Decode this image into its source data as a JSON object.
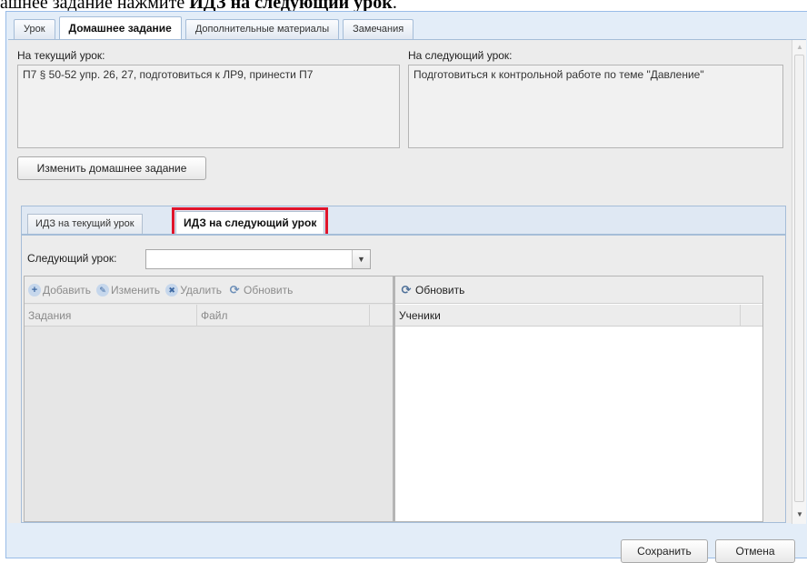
{
  "doc_caption": {
    "text_normal": "ашнее задание нажмите ",
    "text_bold": "ИДЗ на следующий урок",
    "text_end": "."
  },
  "tabs": [
    {
      "label": "Урок",
      "active": false
    },
    {
      "label": "Домашнее задание",
      "active": true
    },
    {
      "label": "Дополнительные материалы",
      "active": false
    },
    {
      "label": "Замечания",
      "active": false
    }
  ],
  "homework": {
    "current_label": "На текущий урок:",
    "current_text": "П7 § 50-52 упр. 26, 27, подготовиться к ЛР9, принести П7",
    "next_label": "На следующий урок:",
    "next_text": "Подготовиться к контрольной работе по теме \"Давление\"",
    "change_button": "Изменить домашнее задание"
  },
  "sub_tabs": [
    {
      "label": "ИДЗ на текущий урок",
      "active": false
    },
    {
      "label": "ИДЗ на следующий урок",
      "active": true
    }
  ],
  "next_lesson": {
    "label": "Следующий урок:",
    "value": ""
  },
  "tasks_toolbar": {
    "add": "Добавить",
    "edit": "Изменить",
    "delete": "Удалить",
    "refresh": "Обновить"
  },
  "tasks_columns": [
    "Задания",
    "Файл"
  ],
  "students_toolbar": {
    "refresh": "Обновить"
  },
  "students_columns": [
    "Ученики"
  ],
  "footer": {
    "save": "Сохранить",
    "cancel": "Отмена"
  },
  "icons": {
    "add": "plus-circle-icon",
    "edit": "pencil-icon",
    "delete": "x-circle-icon",
    "refresh": "refresh-icon"
  },
  "colors": {
    "highlight": "#e0152b",
    "window_bg": "#e3edf8",
    "border": "#99bce8"
  }
}
